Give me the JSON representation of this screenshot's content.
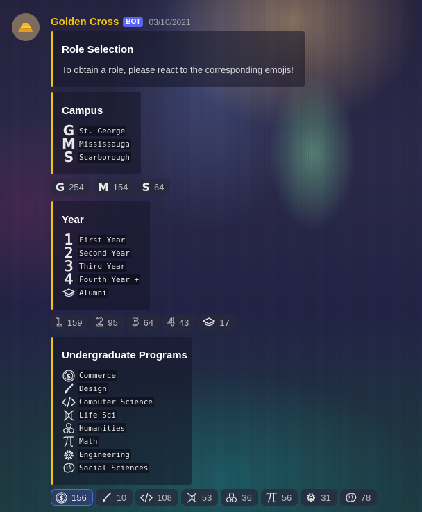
{
  "message": {
    "author": "Golden Cross",
    "bot_tag": "BOT",
    "timestamp": "03/10/2021"
  },
  "embeds": {
    "role_selection": {
      "title": "Role Selection",
      "description": "To obtain a role, please react to the corresponding emojis!"
    },
    "campus": {
      "title": "Campus",
      "items": [
        {
          "emoji": "G",
          "icon": "letter-g-icon",
          "label": "St. George"
        },
        {
          "emoji": "M",
          "icon": "letter-m-icon",
          "label": "Mississauga"
        },
        {
          "emoji": "S",
          "icon": "letter-s-icon",
          "label": "Scarborough"
        }
      ]
    },
    "year": {
      "title": "Year",
      "items": [
        {
          "emoji": "1",
          "icon": "number-one-icon",
          "label": "First Year"
        },
        {
          "emoji": "2",
          "icon": "number-two-icon",
          "label": "Second Year"
        },
        {
          "emoji": "3",
          "icon": "number-three-icon",
          "label": "Third Year"
        },
        {
          "emoji": "4",
          "icon": "number-four-icon",
          "label": "Fourth Year +"
        },
        {
          "emoji": "",
          "icon": "graduation-cap-icon",
          "label": "Alumni"
        }
      ]
    },
    "programs": {
      "title": "Undergraduate Programs",
      "items": [
        {
          "icon": "dollar-coin-icon",
          "label": "Commerce"
        },
        {
          "icon": "paintbrush-icon",
          "label": "Design"
        },
        {
          "icon": "code-icon",
          "label": "Computer Science"
        },
        {
          "icon": "dna-icon",
          "label": "Life Sci"
        },
        {
          "icon": "triskelion-icon",
          "label": "Humanities"
        },
        {
          "icon": "pi-icon",
          "label": "Math"
        },
        {
          "icon": "gear-icon",
          "label": "Engineering"
        },
        {
          "icon": "brain-icon",
          "label": "Social Sciences"
        }
      ]
    }
  },
  "reactions": {
    "campus": [
      {
        "emoji": "G",
        "count": "254"
      },
      {
        "emoji": "M",
        "count": "154"
      },
      {
        "emoji": "S",
        "count": "64"
      }
    ],
    "year": [
      {
        "emoji": "1",
        "count": "159"
      },
      {
        "emoji": "2",
        "count": "95"
      },
      {
        "emoji": "3",
        "count": "64"
      },
      {
        "emoji": "4",
        "count": "43"
      },
      {
        "icon": "graduation-cap-icon",
        "count": "17"
      }
    ],
    "programs": [
      {
        "icon": "dollar-coin-icon",
        "count": "156",
        "active": true
      },
      {
        "icon": "paintbrush-icon",
        "count": "10"
      },
      {
        "icon": "code-icon",
        "count": "108"
      },
      {
        "icon": "dna-icon",
        "count": "53"
      },
      {
        "icon": "triskelion-icon",
        "count": "36"
      },
      {
        "icon": "pi-icon",
        "count": "56"
      },
      {
        "icon": "gear-icon",
        "count": "31"
      },
      {
        "icon": "brain-icon",
        "count": "78"
      }
    ]
  },
  "colors": {
    "embed_accent": "#f1c40f",
    "username": "#f1c40f",
    "bot_badge": "#5865f2"
  }
}
